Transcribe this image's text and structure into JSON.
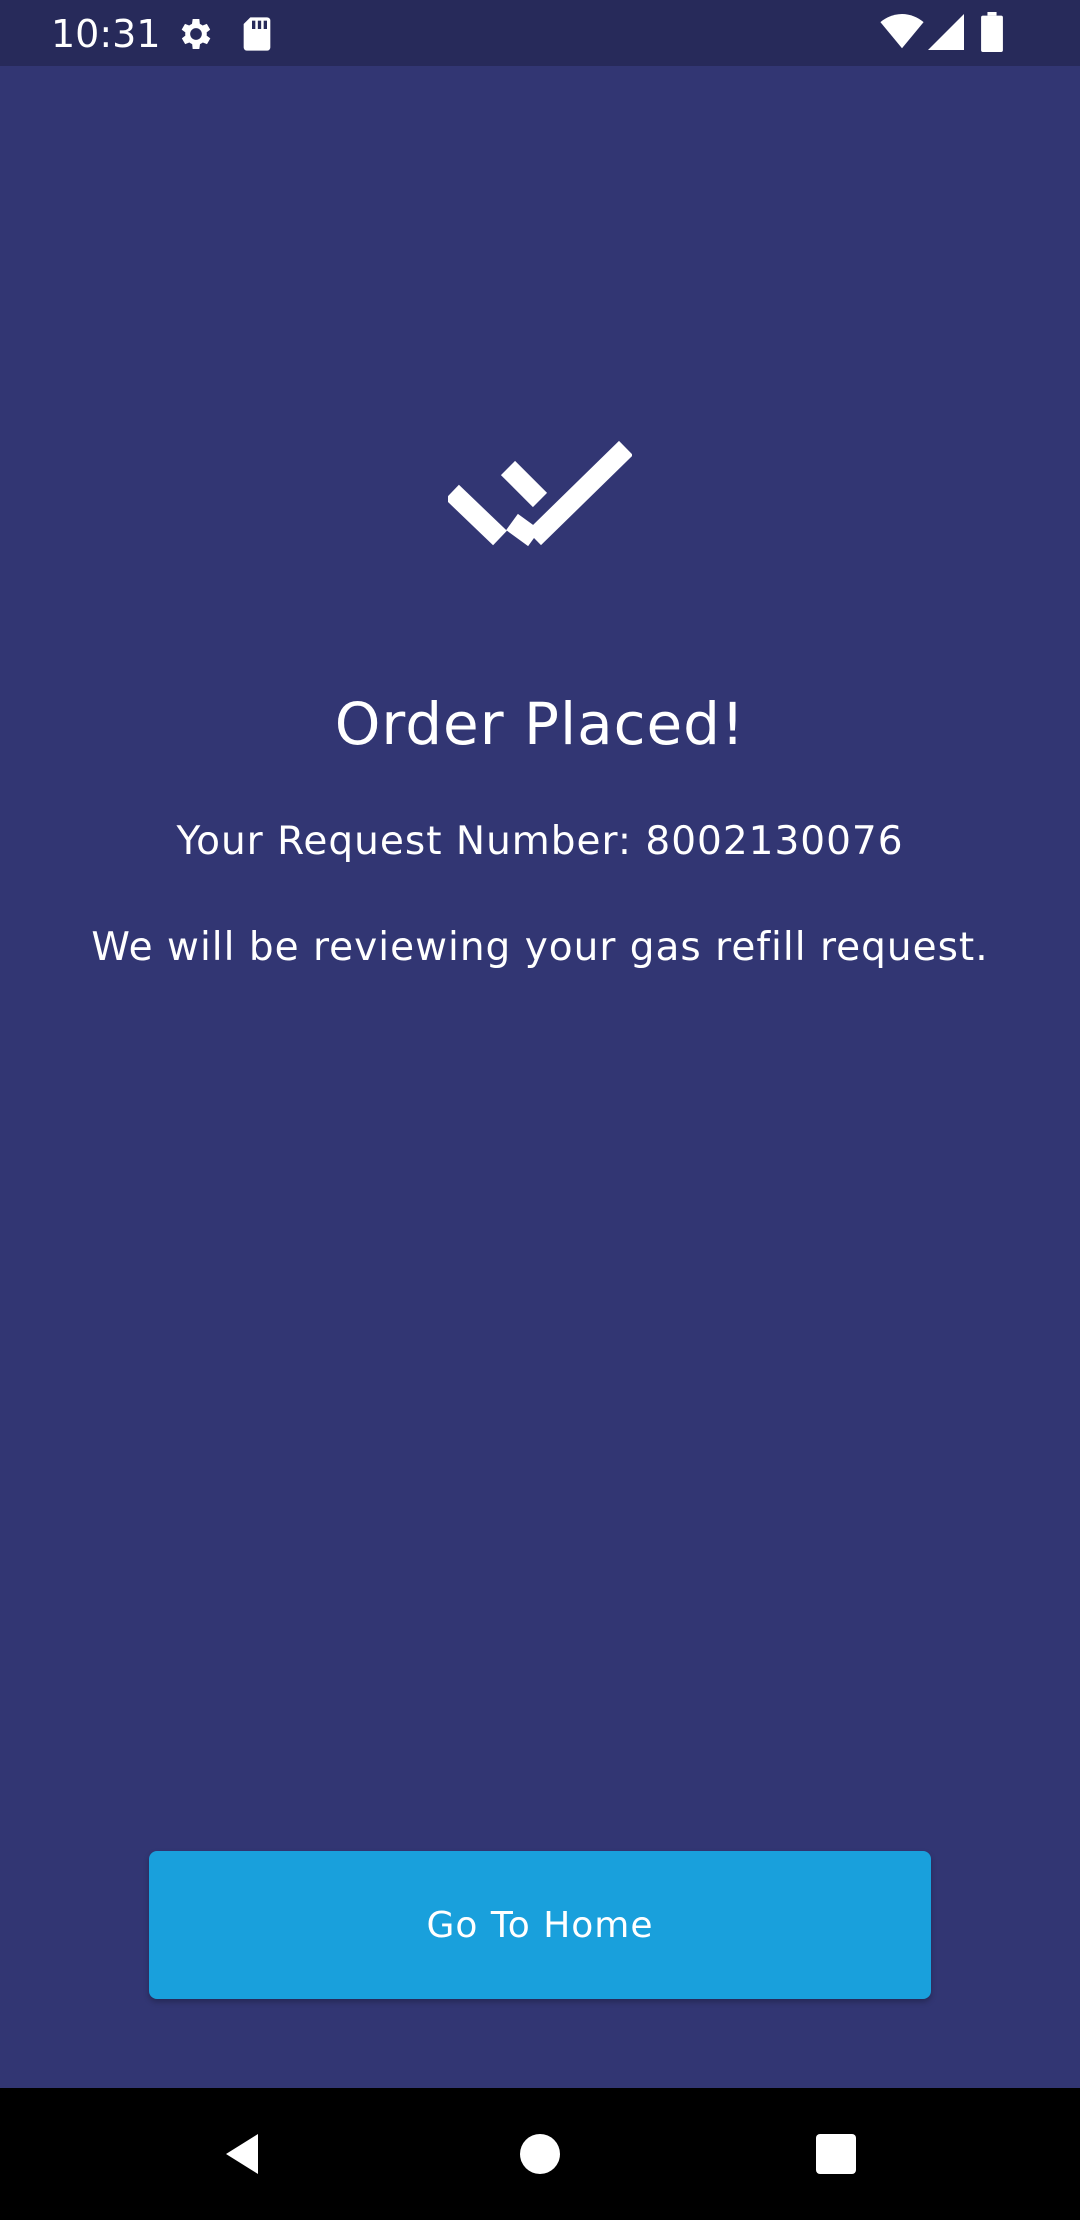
{
  "status_bar": {
    "time": "10:31",
    "icons": [
      "settings-gear-icon",
      "sd-card-icon",
      "wifi-icon",
      "cellular-signal-icon",
      "battery-icon"
    ]
  },
  "confirmation": {
    "icon": "double-check-icon",
    "title": "Order Placed!",
    "request_line": "Your Request Number: 8002130076",
    "message": "We will be reviewing your gas refill request."
  },
  "actions": {
    "home_button_label": "Go To Home"
  },
  "nav_bar": {
    "icons": [
      "back-icon",
      "home-icon",
      "recents-icon"
    ]
  },
  "colors": {
    "background": "#323673",
    "status_bar": "#272a5a",
    "button": "#19a0dc",
    "text": "#ffffff",
    "nav_bar": "#000000"
  }
}
